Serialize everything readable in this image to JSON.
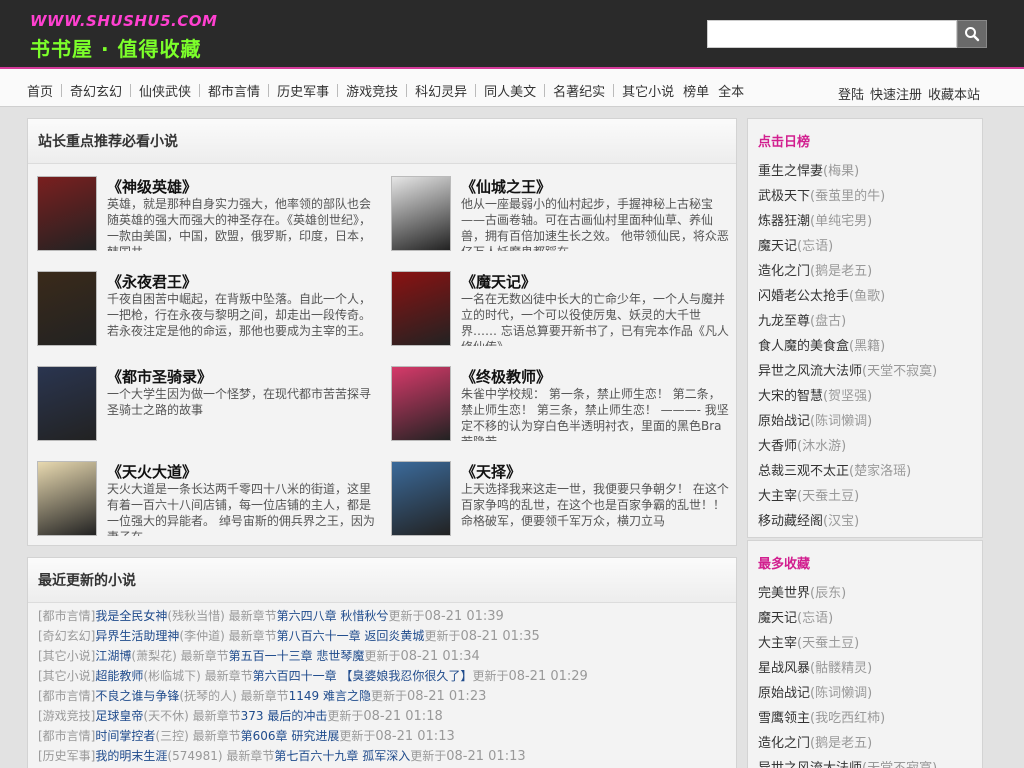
{
  "header": {
    "logo_url": "WWW.SHUSHU5.COM",
    "logo_name": "书书屋 · 值得收藏",
    "search_placeholder": "",
    "search_value": ""
  },
  "nav": {
    "items": [
      "首页",
      "奇幻玄幻",
      "仙侠武侠",
      "都市言情",
      "历史军事",
      "游戏竞技",
      "科幻灵异",
      "同人美文",
      "名著纪实",
      "其它小说",
      "榜单",
      "全本"
    ],
    "right": [
      "登陆",
      "快速注册",
      "收藏本站"
    ]
  },
  "recommend": {
    "title": "站长重点推荐必看小说",
    "books": [
      {
        "title": "《神级英雄》",
        "desc": "英雄，就是那种自身实力强大，他率领的部队也会随英雄的强大而强大的神圣存在。《英雄创世纪》，一款由美国，中国，欧盟，俄罗斯，印度，日本，韩国共",
        "cover_color": "#7a1f1f"
      },
      {
        "title": "《仙城之王》",
        "desc": "他从一座最弱小的仙村起步，手握神秘上古秘宝——古画卷轴。可在古画仙村里面种仙草、养仙兽，拥有百倍加速生长之效。 他带领仙民，将众恶亿万人妖魔鬼都踩在",
        "cover_color": "#e6e6e6"
      },
      {
        "title": "《永夜君王》",
        "desc": "千夜自困苦中崛起，在背叛中坠落。自此一个人，一把枪，行在永夜与黎明之间，却走出一段传奇。若永夜注定是他的命运，那他也要成为主宰的王。",
        "cover_color": "#3a2a1a"
      },
      {
        "title": "《魔天记》",
        "desc": "一名在无数凶徒中长大的亡命少年，一个人与魔并立的时代，一个可以役使厉鬼、妖灵的大千世界…… 忘语总算要开新书了，已有完本作品《凡人修仙传》",
        "cover_color": "#8a1212"
      },
      {
        "title": "《都市圣骑录》",
        "desc": "一个大学生因为做一个怪梦，在现代都市苦苦探寻圣骑士之路的故事",
        "cover_color": "#2a3550"
      },
      {
        "title": "《终极教师》",
        "desc": "朱雀中学校规： 第一条，禁止师生恋！ 第二条，禁止师生恋！ 第三条，禁止师生恋！ ———- 我坚定不移的认为穿白色半透明衬衣，里面的黑色Bra若隐若",
        "cover_color": "#d63a6a"
      },
      {
        "title": "《天火大道》",
        "desc": "天火大道是一条长达两千零四十八米的街道，这里有着一百六十八间店铺，每一位店铺的主人，都是一位强大的异能者。 绰号宙斯的佣兵界之王，因为妻子在",
        "cover_color": "#e8d9b0"
      },
      {
        "title": "《天择》",
        "desc": "上天选择我来这走一世，我便要只争朝夕！ 在这个百家争鸣的乱世，在这个也是百家争霸的乱世！！ 命格破军，便要领千军万众，横刀立马",
        "cover_color": "#3b6a9a"
      }
    ]
  },
  "updates": {
    "title": "最近更新的小说",
    "rows": [
      {
        "cat": "[都市言情]",
        "book": "我是全民女神",
        "author": "(残秋当惜)",
        "label": "最新章节",
        "chapter": "第六四八章 秋惜秋兮",
        "updated": "更新于",
        "time": "08-21 01:39"
      },
      {
        "cat": "[奇幻玄幻]",
        "book": "异界生活助理神",
        "author": "(李仲道)",
        "label": "最新章节",
        "chapter": "第八百六十一章 返回炎黄城",
        "updated": "更新于",
        "time": "08-21 01:35"
      },
      {
        "cat": "[其它小说]",
        "book": "江湖博",
        "author": "(萧梨花)",
        "label": "最新章节",
        "chapter": "第五百一十三章 悲世琴魔",
        "updated": "更新于",
        "time": "08-21 01:34"
      },
      {
        "cat": "[其它小说]",
        "book": "超能教师",
        "author": "(彬临城下)",
        "label": "最新章节",
        "chapter": "第六百四十一章 【臭婆娘我忍你很久了】",
        "updated": "更新于",
        "time": "08-21 01:29"
      },
      {
        "cat": "[都市言情]",
        "book": "不良之谁与争锋",
        "author": "(抚琴的人)",
        "label": "最新章节",
        "chapter": "1149 难言之隐",
        "updated": "更新于",
        "time": "08-21 01:23"
      },
      {
        "cat": "[游戏竞技]",
        "book": "足球皇帝",
        "author": "(天不休)",
        "label": "最新章节",
        "chapter": "373 最后的冲击",
        "updated": "更新于",
        "time": "08-21 01:18"
      },
      {
        "cat": "[都市言情]",
        "book": "时间掌控者",
        "author": "(三控)",
        "label": "最新章节",
        "chapter": "第606章 研究进展",
        "updated": "更新于",
        "time": "08-21 01:13"
      },
      {
        "cat": "[历史军事]",
        "book": "我的明末生涯",
        "author": "(574981)",
        "label": "最新章节",
        "chapter": "第七百六十九章 孤军深入",
        "updated": "更新于",
        "time": "08-21 01:13"
      }
    ]
  },
  "hot": {
    "title": "点击日榜",
    "items": [
      {
        "book": "重生之悍妻",
        "author": "(梅果)"
      },
      {
        "book": "武极天下",
        "author": "(蚕茧里的牛)"
      },
      {
        "book": "炼器狂潮",
        "author": "(单纯宅男)"
      },
      {
        "book": "魔天记",
        "author": "(忘语)"
      },
      {
        "book": "造化之门",
        "author": "(鹅是老五)"
      },
      {
        "book": "闪婚老公太抢手",
        "author": "(鱼歌)"
      },
      {
        "book": "九龙至尊",
        "author": "(盘古)"
      },
      {
        "book": "食人魔的美食盒",
        "author": "(黑籍)"
      },
      {
        "book": "异世之风流大法师",
        "author": "(天堂不寂寞)"
      },
      {
        "book": "大宋的智慧",
        "author": "(贺坚强)"
      },
      {
        "book": "原始战记",
        "author": "(陈词懒调)"
      },
      {
        "book": "大香师",
        "author": "(沐水游)"
      },
      {
        "book": "总裁三观不太正",
        "author": "(楚家洛瑶)"
      },
      {
        "book": "大主宰",
        "author": "(天蚕土豆)"
      },
      {
        "book": "移动藏经阁",
        "author": "(汉宝)"
      }
    ]
  },
  "fav": {
    "title": "最多收藏",
    "items": [
      {
        "book": "完美世界",
        "author": "(辰东)"
      },
      {
        "book": "魔天记",
        "author": "(忘语)"
      },
      {
        "book": "大主宰",
        "author": "(天蚕土豆)"
      },
      {
        "book": "星战风暴",
        "author": "(骷髅精灵)"
      },
      {
        "book": "原始战记",
        "author": "(陈词懒调)"
      },
      {
        "book": "雪鹰领主",
        "author": "(我吃西红柿)"
      },
      {
        "book": "造化之门",
        "author": "(鹅是老五)"
      },
      {
        "book": "异世之风流大法师",
        "author": "(天堂不寂寞)"
      }
    ]
  }
}
